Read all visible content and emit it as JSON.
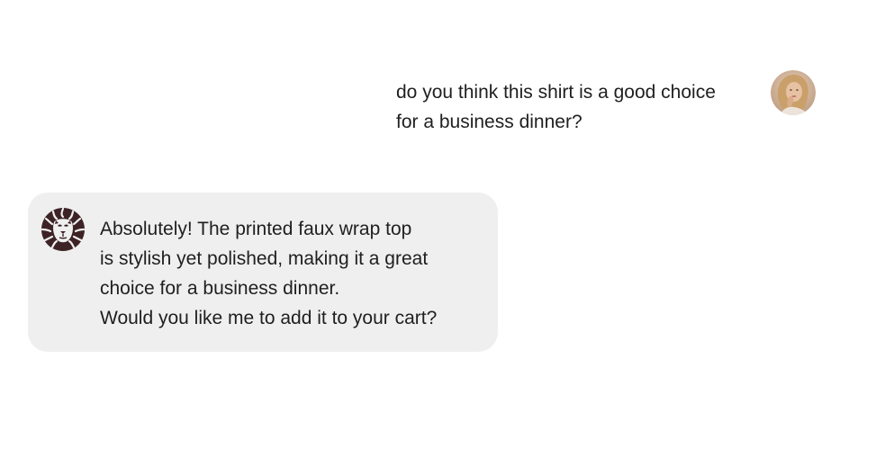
{
  "user_message": {
    "lines": [
      "do you think this shirt is a good choice",
      "for a business dinner?"
    ],
    "avatar_icon": "user-photo-avatar"
  },
  "bot_message": {
    "lines": [
      "Absolutely! The printed faux wrap top",
      "is stylish yet polished, making it a great",
      "choice for a business dinner.",
      "Would you like me to add it to your cart?"
    ],
    "avatar_icon": "lion-logo-icon",
    "bubble_color": "#efefef",
    "logo_color": "#3d2226"
  }
}
